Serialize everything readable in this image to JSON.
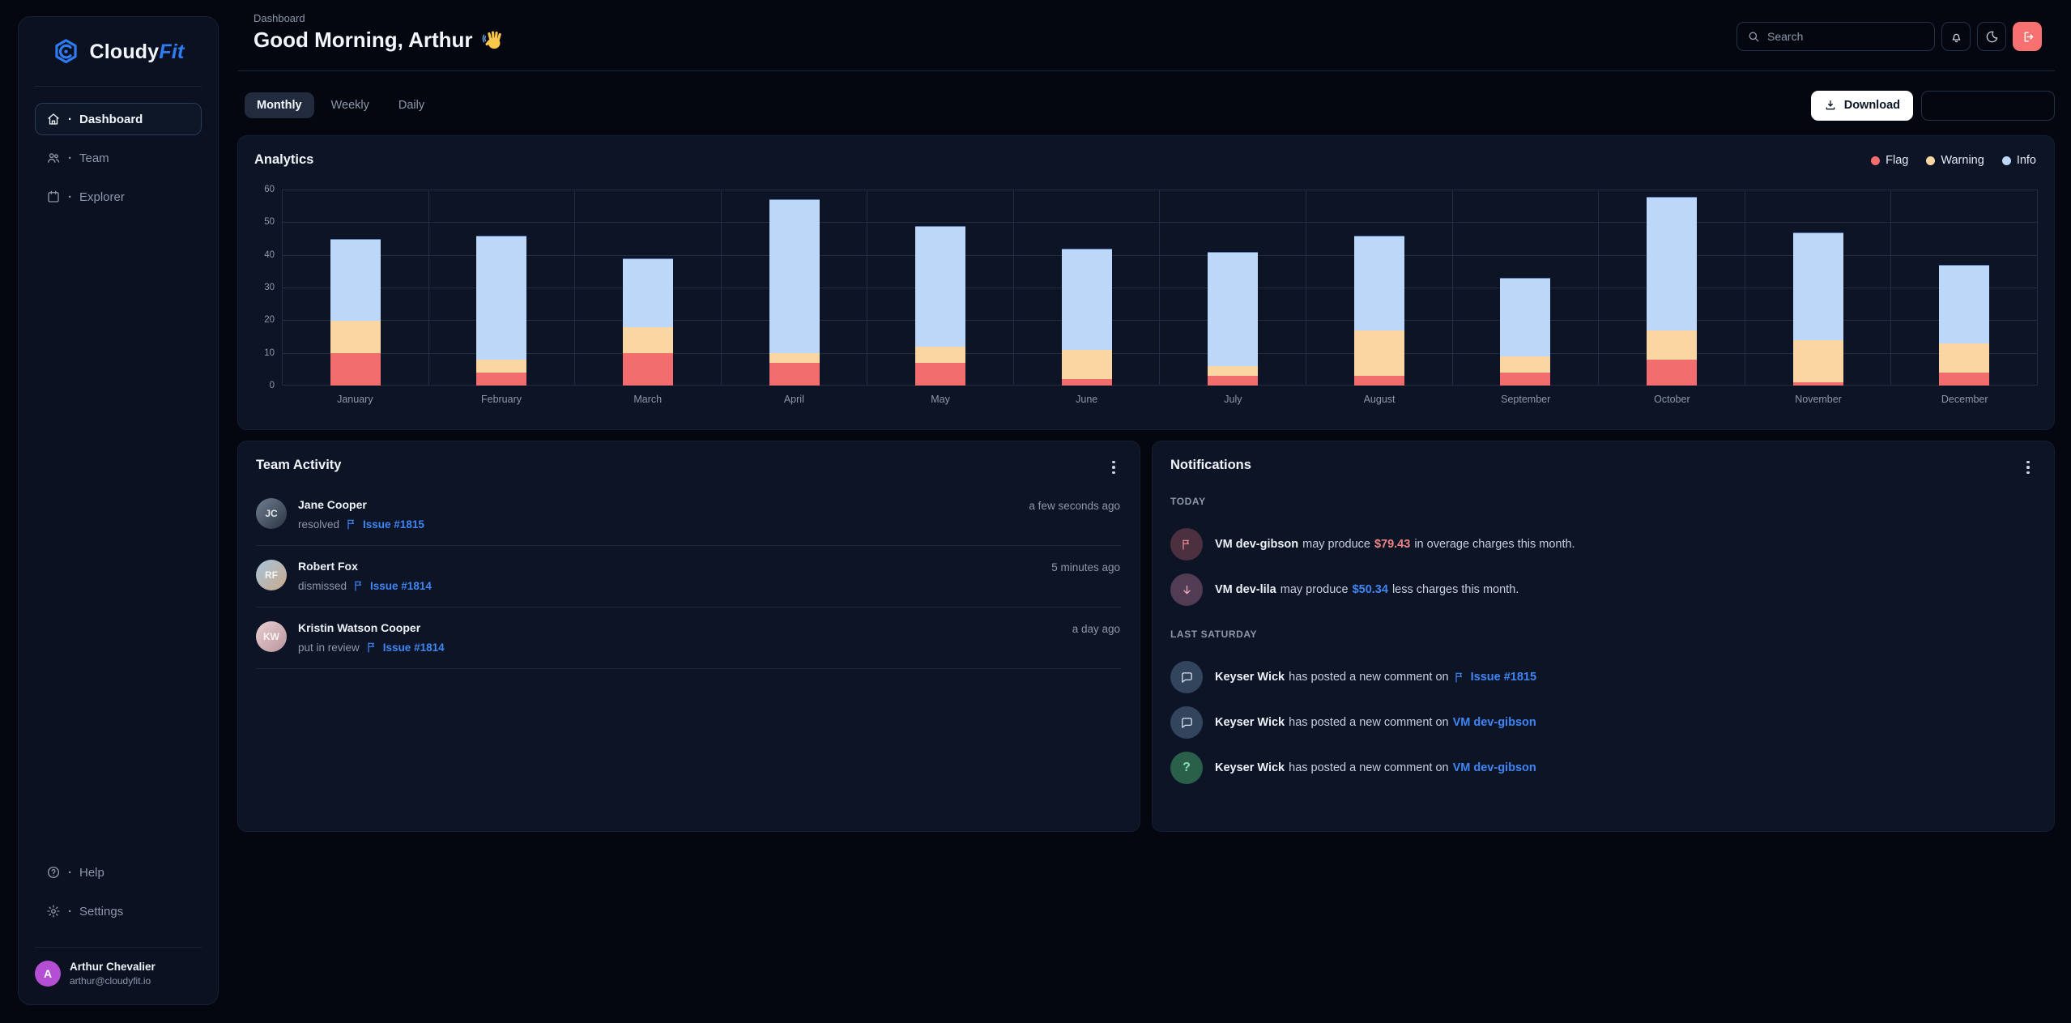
{
  "brand": {
    "name_primary": "Cloudy",
    "name_accent": "Fit",
    "accent_color": "#2e7cf6"
  },
  "sidebar": {
    "items": [
      {
        "label": "Dashboard",
        "icon": "home",
        "active": true
      },
      {
        "label": "Team",
        "icon": "users",
        "active": false
      },
      {
        "label": "Explorer",
        "icon": "calendar",
        "active": false
      }
    ],
    "footer_items": [
      {
        "label": "Help",
        "icon": "help",
        "active": false
      },
      {
        "label": "Settings",
        "icon": "gear",
        "active": false
      }
    ],
    "user": {
      "name": "Arthur Chevalier",
      "email": "arthur@cloudyfit.io",
      "initial": "A",
      "avatar_color": "#b44fd3"
    }
  },
  "header": {
    "breadcrumb": "Dashboard",
    "title": "Good Morning, Arthur",
    "wave_icon": "waving-hand-emoji",
    "search_placeholder": "Search",
    "logout_color": "#f87171"
  },
  "toolbar": {
    "tabs": [
      {
        "label": "Monthly",
        "active": true
      },
      {
        "label": "Weekly",
        "active": false
      },
      {
        "label": "Daily",
        "active": false
      }
    ],
    "download_label": "Download",
    "date_field_value": ""
  },
  "analytics": {
    "title": "Analytics",
    "legend": [
      {
        "label": "Flag",
        "color": "#f26d6d"
      },
      {
        "label": "Warning",
        "color": "#fad7a2"
      },
      {
        "label": "Info",
        "color": "#bdd7f8"
      }
    ]
  },
  "chart_data": {
    "type": "bar",
    "stacked": true,
    "title": "Analytics",
    "categories": [
      "January",
      "February",
      "March",
      "April",
      "May",
      "June",
      "July",
      "August",
      "September",
      "October",
      "November",
      "December"
    ],
    "series": [
      {
        "name": "Flag",
        "color": "#f26d6d",
        "values": [
          10,
          4,
          10,
          7,
          7,
          2,
          3,
          3,
          4,
          8,
          1,
          4
        ]
      },
      {
        "name": "Warning",
        "color": "#fad7a2",
        "values": [
          10,
          4,
          8,
          3,
          5,
          9,
          3,
          14,
          5,
          9,
          13,
          9
        ]
      },
      {
        "name": "Info",
        "color": "#bdd7f8",
        "values": [
          25,
          38,
          21,
          47,
          37,
          31,
          35,
          29,
          24,
          41,
          33,
          24
        ]
      }
    ],
    "totals": [
      45,
      46,
      39,
      57,
      49,
      42,
      41,
      46,
      33,
      58,
      47,
      37
    ],
    "ylim": [
      0,
      60
    ],
    "yticks": [
      0,
      10,
      20,
      30,
      40,
      50,
      60
    ],
    "grid": true,
    "legend_position": "top-right"
  },
  "team_activity": {
    "title": "Team Activity",
    "items": [
      {
        "name": "Jane Cooper",
        "action": "resolved",
        "issue": "Issue #1815",
        "time": "a few seconds ago",
        "avatar": {
          "initials": "JC",
          "colors": [
            "#6f7f92",
            "#2b3442"
          ]
        }
      },
      {
        "name": "Robert Fox",
        "action": "dismissed",
        "issue": "Issue #1814",
        "time": "5 minutes ago",
        "avatar": {
          "initials": "RF",
          "colors": [
            "#a8c4dd",
            "#c9a98b"
          ]
        }
      },
      {
        "name": "Kristin Watson Cooper",
        "action": "put in review",
        "issue": "Issue #1814",
        "time": "a day ago",
        "avatar": {
          "initials": "KW",
          "colors": [
            "#e8cfd2",
            "#b9969b"
          ]
        }
      }
    ]
  },
  "notifications": {
    "title": "Notifications",
    "sections": [
      {
        "label": "TODAY",
        "items": [
          {
            "icon": "flag",
            "icon_bg": "#4b3040",
            "icon_color": "#ec8f9c",
            "parts": [
              {
                "t": "VM dev-gibson",
                "bold": true
              },
              {
                "t": " may produce "
              },
              {
                "t": "$79.43",
                "bold": true,
                "color": "#ef8484"
              },
              {
                "t": " in overage charges this month."
              }
            ]
          },
          {
            "icon": "arrow-down",
            "icon_bg": "#523c54",
            "icon_color": "#f0a9bd",
            "parts": [
              {
                "t": "VM dev-lila",
                "bold": true
              },
              {
                "t": " may produce "
              },
              {
                "t": "$50.34",
                "bold": true,
                "color": "#3f86f4"
              },
              {
                "t": " less charges this month."
              }
            ]
          }
        ]
      },
      {
        "label": "LAST SATURDAY",
        "items": [
          {
            "icon": "comment",
            "icon_bg": "#32455d",
            "icon_color": "#d9e5f6",
            "parts": [
              {
                "t": "Keyser Wick",
                "bold": true
              },
              {
                "t": " has posted a new comment on "
              },
              {
                "t": "Issue #1815",
                "bold": true,
                "color": "#3f86f4",
                "link": true,
                "flag": true
              }
            ]
          },
          {
            "icon": "comment",
            "icon_bg": "#32455d",
            "icon_color": "#d9e5f6",
            "parts": [
              {
                "t": "Keyser Wick",
                "bold": true
              },
              {
                "t": " has posted a new comment on "
              },
              {
                "t": "VM dev-gibson",
                "bold": true,
                "color": "#3f86f4",
                "link": true
              }
            ]
          },
          {
            "icon": "question",
            "icon_bg": "#2a6049",
            "icon_color": "#83dfae",
            "parts": [
              {
                "t": "Keyser Wick",
                "bold": true
              },
              {
                "t": " has posted a new comment on "
              },
              {
                "t": "VM dev-gibson",
                "bold": true,
                "color": "#3f86f4",
                "link": true
              }
            ]
          }
        ]
      }
    ]
  }
}
